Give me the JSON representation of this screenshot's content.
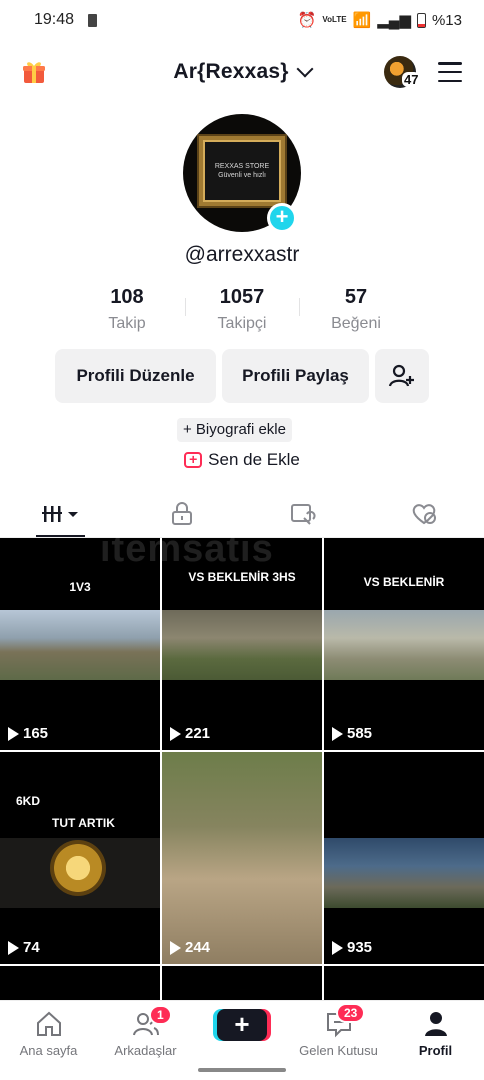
{
  "status_bar": {
    "time": "19:48",
    "network": "VoLTE",
    "battery": "%13"
  },
  "header": {
    "display_name": "Ar{Rexxas}",
    "account_badge": "47"
  },
  "profile": {
    "avatar_text_line1": "REXXAS STORE",
    "avatar_text_line2": "Güvenli ve hızlı",
    "handle": "@arrexxastr",
    "stats": [
      {
        "value": "108",
        "label": "Takip"
      },
      {
        "value": "1057",
        "label": "Takipçi"
      },
      {
        "value": "57",
        "label": "Beğeni"
      }
    ],
    "edit_label": "Profili Düzenle",
    "share_label": "Profili Paylaş",
    "bio_label": "+ Biyografi ekle",
    "add_me_label": "Sen de Ekle"
  },
  "tabs": [
    {
      "icon": "grid-icon",
      "active": true
    },
    {
      "icon": "lock-icon",
      "active": false
    },
    {
      "icon": "repost-icon",
      "active": false
    },
    {
      "icon": "liked-icon",
      "active": false
    }
  ],
  "watermark": "itemsatis",
  "videos": [
    {
      "caption": "1V3",
      "plays": "165"
    },
    {
      "caption": "VS BEKLENİR 3HS",
      "plays": "221"
    },
    {
      "caption": "VS BEKLENİR",
      "plays": "585"
    },
    {
      "caption": "6KD",
      "caption2": "TUT ARTIK",
      "plays": "74"
    },
    {
      "caption": "",
      "plays": "244"
    },
    {
      "caption": "",
      "plays": "935"
    }
  ],
  "bottom_nav": {
    "home": "Ana sayfa",
    "friends": "Arkadaşlar",
    "friends_badge": "1",
    "create": "+",
    "inbox": "Gelen Kutusu",
    "inbox_badge": "23",
    "profile": "Profil"
  }
}
